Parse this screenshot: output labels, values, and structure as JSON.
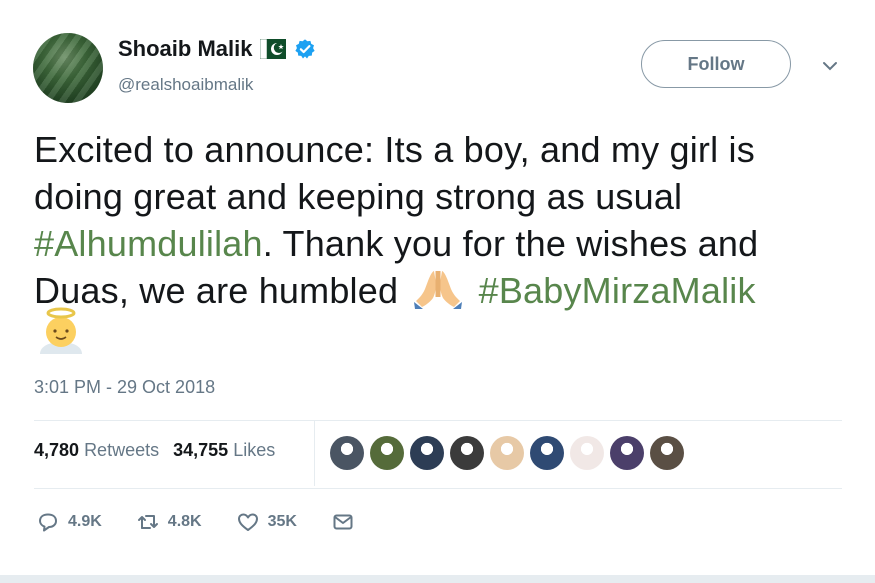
{
  "author": {
    "name": "Shoaib Malik",
    "handle": "@realshoaibmalik"
  },
  "follow_label": "Follow",
  "tweet": {
    "text_line1": "Excited to announce: Its a boy, and my girl is",
    "text_line2": "doing great and keeping strong as usual",
    "hashtag1": "#Alhumdulilah",
    "text_line3_rest": ". Thank you for the wishes and",
    "text_line4": "Duas, we are humbled",
    "hashtag2": "#BabyMirzaMalik"
  },
  "timestamp": "3:01 PM - 29 Oct 2018",
  "stats": {
    "retweets_count": "4,780",
    "retweets_label": "Retweets",
    "likes_count": "34,755",
    "likes_label": "Likes"
  },
  "liker_avatar_colors": [
    "#4a5563",
    "#556b3a",
    "#2d3d55",
    "#3b3b3b",
    "#e7c9a6",
    "#2f4a73",
    "#f1e8e6",
    "#4b3f6a",
    "#5a4f44"
  ],
  "actions": {
    "reply": "4.9K",
    "retweet": "4.8K",
    "like": "35K"
  },
  "colors": {
    "hashtag": "#58864c",
    "verified": "#1da1f2",
    "secondary_text": "#657786"
  }
}
